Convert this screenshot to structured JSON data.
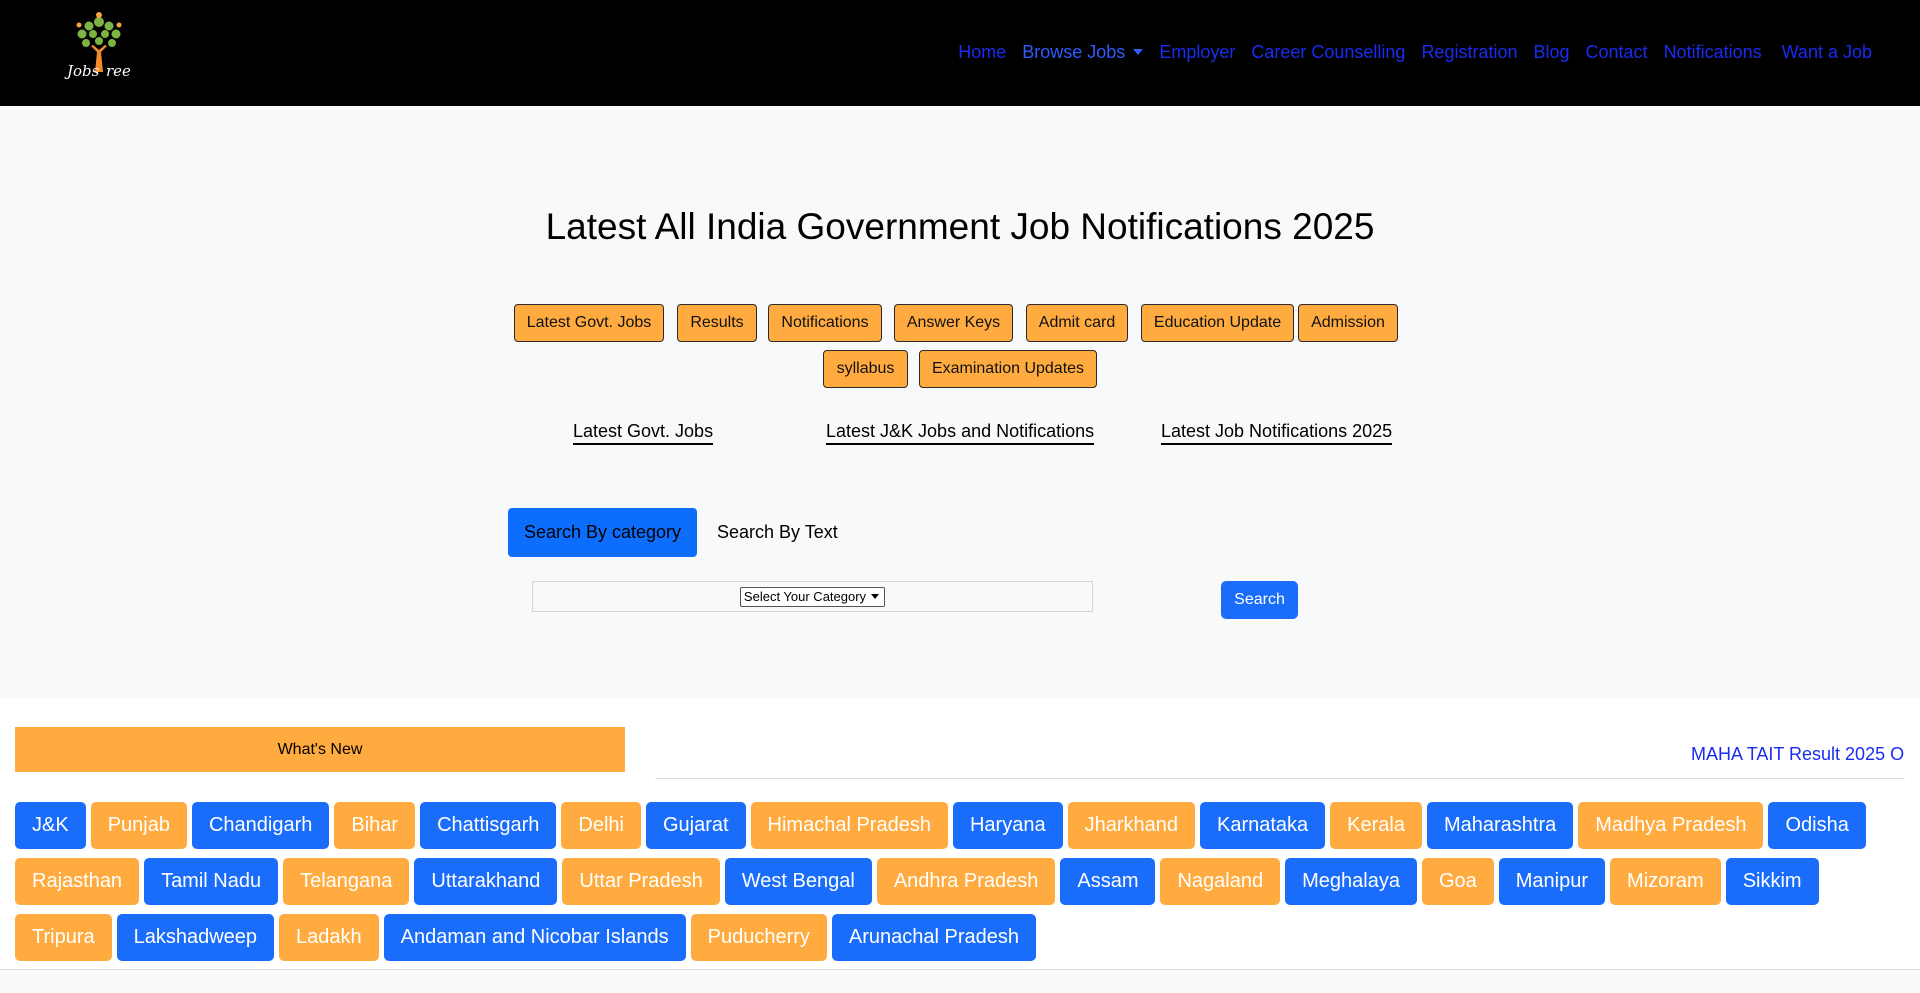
{
  "header": {
    "logo_text": "JobsTree",
    "nav": {
      "home": "Home",
      "browse": "Browse Jobs",
      "employer": "Employer",
      "career": "Career Counselling",
      "registration": "Registration",
      "blog": "Blog",
      "contact": "Contact",
      "notifications": "Notifications",
      "want": "Want a Job"
    }
  },
  "hero": {
    "title": "Latest All India Government Job Notifications 2025",
    "chips": [
      "Latest Govt. Jobs",
      "Results",
      "Notifications",
      "Answer Keys",
      "Admit card",
      "Education Update",
      "Admission",
      "syllabus",
      "Examination Updates"
    ],
    "links": [
      "Latest Govt. Jobs",
      "Latest J&K Jobs and Notifications",
      "Latest Job Notifications 2025"
    ]
  },
  "search": {
    "tab_category": "Search By category",
    "tab_text": "Search By Text",
    "select_value": "Select Your Category",
    "button": "Search"
  },
  "whats_new": {
    "label": "What's New",
    "ticker": "MAHA TAIT Result 2025 O"
  },
  "states": [
    {
      "label": "J&K",
      "color": "blue"
    },
    {
      "label": "Punjab",
      "color": "orange"
    },
    {
      "label": "Chandigarh",
      "color": "blue"
    },
    {
      "label": "Bihar",
      "color": "orange"
    },
    {
      "label": "Chattisgarh",
      "color": "blue"
    },
    {
      "label": "Delhi",
      "color": "orange"
    },
    {
      "label": "Gujarat",
      "color": "blue"
    },
    {
      "label": "Himachal Pradesh",
      "color": "orange"
    },
    {
      "label": "Haryana",
      "color": "blue"
    },
    {
      "label": "Jharkhand",
      "color": "orange"
    },
    {
      "label": "Karnataka",
      "color": "blue"
    },
    {
      "label": "Kerala",
      "color": "orange"
    },
    {
      "label": "Maharashtra",
      "color": "blue"
    },
    {
      "label": "Madhya Pradesh",
      "color": "orange"
    },
    {
      "label": "Odisha",
      "color": "blue"
    },
    {
      "label": "Rajasthan",
      "color": "orange"
    },
    {
      "label": "Tamil Nadu",
      "color": "blue"
    },
    {
      "label": "Telangana",
      "color": "orange"
    },
    {
      "label": "Uttarakhand",
      "color": "blue"
    },
    {
      "label": "Uttar Pradesh",
      "color": "orange"
    },
    {
      "label": "West Bengal",
      "color": "blue"
    },
    {
      "label": "Andhra Pradesh",
      "color": "orange"
    },
    {
      "label": "Assam",
      "color": "blue"
    },
    {
      "label": "Nagaland",
      "color": "orange"
    },
    {
      "label": "Meghalaya",
      "color": "blue"
    },
    {
      "label": "Goa",
      "color": "orange"
    },
    {
      "label": "Manipur",
      "color": "blue"
    },
    {
      "label": "Mizoram",
      "color": "orange"
    },
    {
      "label": "Sikkim",
      "color": "blue"
    },
    {
      "label": "Tripura",
      "color": "orange"
    },
    {
      "label": "Lakshadweep",
      "color": "blue"
    },
    {
      "label": "Ladakh",
      "color": "orange"
    },
    {
      "label": "Andaman and Nicobar Islands",
      "color": "blue"
    },
    {
      "label": "Puducherry",
      "color": "orange"
    },
    {
      "label": "Arunachal Pradesh",
      "color": "blue"
    }
  ],
  "colors": {
    "blue": "#1a6dfa",
    "orange": "#ffab40",
    "nav_link": "#1a2cf0"
  }
}
